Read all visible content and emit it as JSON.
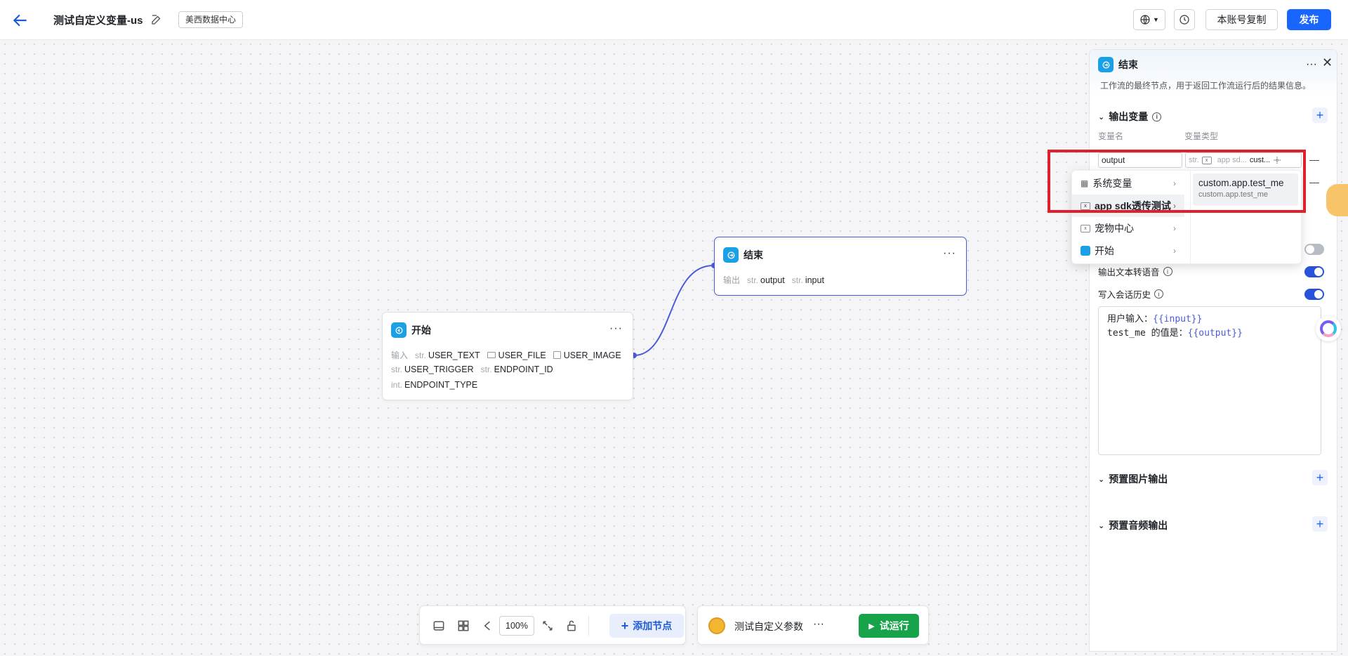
{
  "header": {
    "title": "测试自定义变量-us",
    "region": "美西数据中心",
    "copy_label": "本账号复制",
    "publish_label": "发布"
  },
  "start_node": {
    "title": "开始",
    "more": "···",
    "input_label": "输入",
    "vars": [
      {
        "type": "str.",
        "name": "USER_TEXT"
      },
      {
        "type": "folder",
        "name": "USER_FILE"
      },
      {
        "type": "image",
        "name": "USER_IMAGE"
      },
      {
        "type": "str.",
        "name": "USER_TRIGGER"
      },
      {
        "type": "str.",
        "name": "ENDPOINT_ID"
      },
      {
        "type": "int.",
        "name": "ENDPOINT_TYPE"
      }
    ]
  },
  "end_node": {
    "title": "结束",
    "more": "···",
    "output_label": "输出",
    "vars": [
      {
        "type": "str.",
        "name": "output"
      },
      {
        "type": "str.",
        "name": "input"
      }
    ]
  },
  "panel": {
    "title": "结束",
    "description": "工作流的最终节点，用于返回工作流运行后的结果信息。",
    "output_section": "输出变量",
    "col_name": "变量名",
    "col_type": "变量类型",
    "row_name_value": "output",
    "row_type_prefix": "str.",
    "row_type_source": "app sd...",
    "row_type_value": "cust...",
    "tts_label": "输出文本转语音",
    "history_label": "写入会话历史",
    "template_line1_text": "用户输入：",
    "template_line1_var": "{{input}}",
    "template_line2_text": "test_me 的值是：",
    "template_line2_var": "{{output}}",
    "image_section": "预置图片输出",
    "audio_section": "预置音频输出",
    "toggles": {
      "hidden_row": false,
      "tts": true,
      "history": true
    }
  },
  "dropdown": {
    "items": [
      {
        "label": "系统变量",
        "icon": "grid-icon"
      },
      {
        "label": "app sdk透传测试",
        "icon": "sdk-icon"
      },
      {
        "label": "宠物中心",
        "icon": "sdk-icon"
      },
      {
        "label": "开始",
        "icon": "start-icon"
      }
    ],
    "submenu_title": "custom.app.test_me",
    "submenu_sub": "custom.app.test_me"
  },
  "toolbar": {
    "zoom": "100%",
    "add_node_label": "添加节点",
    "test_params_label": "测试自定义参数",
    "more": "···",
    "run_label": "试运行"
  }
}
